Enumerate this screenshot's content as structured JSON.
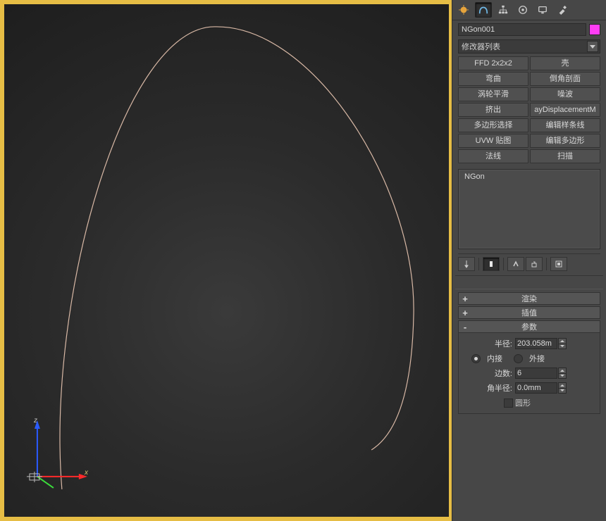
{
  "object_name": "NGon001",
  "object_color": "#ff3df4",
  "modifier_dropdown": {
    "label": "修改器列表"
  },
  "modifiers": [
    "FFD 2x2x2",
    "壳",
    "弯曲",
    "倒角剖面",
    "涡轮平滑",
    "噪波",
    "挤出",
    "ayDisplacementM",
    "多边形选择",
    "编辑样条线",
    "UVW 贴图",
    "编辑多边形",
    "法线",
    "扫描"
  ],
  "stack": {
    "item": "NGon"
  },
  "rollouts": {
    "render": {
      "title": "渲染",
      "state": "+"
    },
    "interp": {
      "title": "插值",
      "state": "+"
    },
    "params": {
      "title": "参数",
      "state": "-",
      "radius_label": "半径:",
      "radius_value": "203.058m",
      "inscribed_label": "内接",
      "circumscribed_label": "外接",
      "sides_label": "边数:",
      "sides_value": "6",
      "corner_radius_label": "角半径:",
      "corner_radius_value": "0.0mm",
      "circular_label": "圆形"
    }
  },
  "axes": {
    "x": "x",
    "z": "z"
  }
}
